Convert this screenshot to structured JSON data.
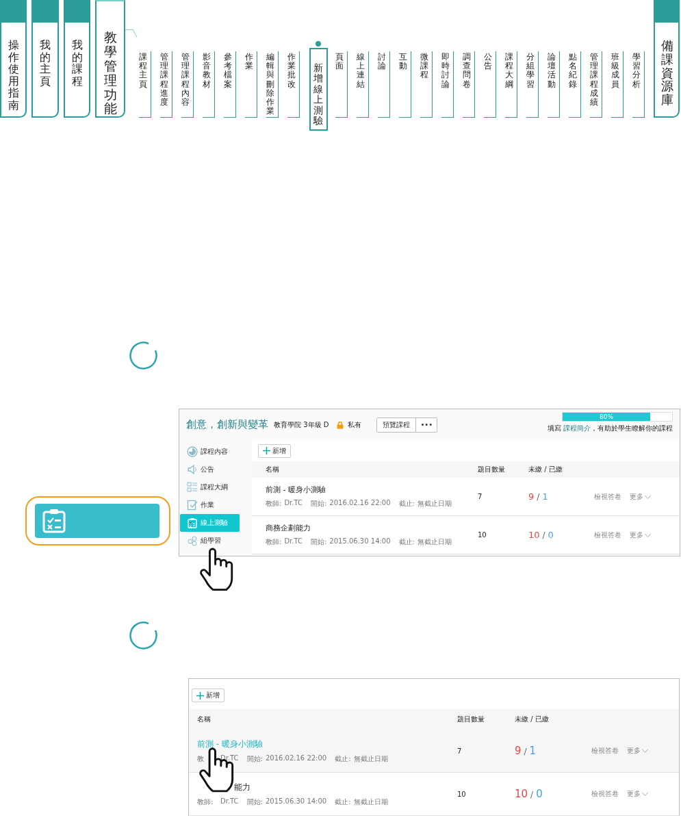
{
  "main_tabs": [
    {
      "label": "操作使用指南",
      "selected": false
    },
    {
      "label": "我的主頁",
      "selected": false
    },
    {
      "label": "我的課程",
      "selected": false
    },
    {
      "label": "教學管理功能",
      "selected": true
    }
  ],
  "sub_tabs": [
    {
      "label": "課程主頁",
      "selected": false
    },
    {
      "label": "管理課程進度",
      "selected": false
    },
    {
      "label": "管理課程內容",
      "selected": false
    },
    {
      "label": "影音教材",
      "selected": false
    },
    {
      "label": "參考檔案",
      "selected": false
    },
    {
      "label": "作業",
      "selected": false
    },
    {
      "label": "編輯與刪除作業",
      "selected": false
    },
    {
      "label": "作業批改",
      "selected": false
    },
    {
      "label": "新增線上測驗",
      "selected": true
    },
    {
      "label": "頁面",
      "selected": false
    },
    {
      "label": "線上連結",
      "selected": false
    },
    {
      "label": "討論",
      "selected": false
    },
    {
      "label": "互動",
      "selected": false
    },
    {
      "label": "微課程",
      "selected": false
    },
    {
      "label": "即時討論",
      "selected": false
    },
    {
      "label": "調查問卷",
      "selected": false
    },
    {
      "label": "公告",
      "selected": false
    },
    {
      "label": "課程大綱",
      "selected": false
    },
    {
      "label": "分組學習",
      "selected": false
    },
    {
      "label": "論壇活動",
      "selected": false
    },
    {
      "label": "點名紀錄",
      "selected": false
    },
    {
      "label": "管理課程成績",
      "selected": false
    },
    {
      "label": "班級成員",
      "selected": false
    },
    {
      "label": "學習分析",
      "selected": false
    }
  ],
  "right_tab": {
    "label": "備課資源庫",
    "selected": false
  },
  "screenshot_1": {
    "course_title": "創意，創新與變革",
    "course_meta": "教育學院 3年級 D",
    "privacy": "私有",
    "preview_button": "預覽課程",
    "more_button": "•••",
    "progress": {
      "level": 0.8,
      "reading": "80%"
    },
    "hint": {
      "prefix": "填寫",
      "link": "課程簡介",
      "suffix": "，有助於學生瞭解你的課程"
    },
    "sidebar": {
      "items": [
        {
          "label": "課程內容",
          "selected": false
        },
        {
          "label": "公告",
          "selected": false
        },
        {
          "label": "課程大綱",
          "selected": false
        },
        {
          "label": "作業",
          "selected": false
        },
        {
          "label": "線上測驗",
          "selected": true
        },
        {
          "label": "組學習",
          "selected": false
        }
      ]
    },
    "add_button": "新增",
    "table": {
      "columns": [
        "名稱",
        "題目數量",
        "未繳 / 已繳"
      ],
      "rows": [
        {
          "name": "前測 - 暖身小測驗",
          "teacher_label": "教師:",
          "teacher": "Dr.TC",
          "start_label": "開始:",
          "start": "2016.02.16 22:00",
          "end_label": "截止:",
          "end": "無截止日期",
          "count": "7",
          "unsubmitted": "9",
          "separator": "/",
          "submitted": "1",
          "view": "檢視答卷",
          "more": "更多"
        },
        {
          "name": "商務企劃能力",
          "teacher_label": "教師:",
          "teacher": "Dr.TC",
          "start_label": "開始:",
          "start": "2015.06.30 14:00",
          "end_label": "截止:",
          "end": "無截止日期",
          "count": "10",
          "unsubmitted": "10",
          "separator": "/",
          "submitted": "0",
          "view": "檢視答卷",
          "more": "更多"
        }
      ]
    }
  },
  "screenshot_2": {
    "add_button": "新增",
    "table": {
      "columns": [
        "名稱",
        "題目數量",
        "未繳 / 已繳"
      ],
      "rows": [
        {
          "kind": "full",
          "name": "前測 - 暖身小測驗",
          "teacher_label": "教",
          "teacher": "Dr.TC",
          "start_label": "開始:",
          "start": "2016.02.16 22:00",
          "end_label": "截止:",
          "end": "無截止日期",
          "count": "7",
          "unsubmitted": "9",
          "separator": "/",
          "submitted": "1",
          "view": "檢視答卷",
          "more": "更多",
          "selected": true
        },
        {
          "kind": "covered",
          "name": "能力",
          "teacher_label": "教師:",
          "teacher": "Dr.TC",
          "start_label": "開始:",
          "start": "2015.06.30 14:00",
          "end_label": "截止:",
          "end": "無截止日期",
          "count": "10",
          "unsubmitted": "10",
          "separator": "/",
          "submitted": "0",
          "view": "檢視答卷",
          "more": "更多",
          "selected": false
        }
      ]
    }
  }
}
